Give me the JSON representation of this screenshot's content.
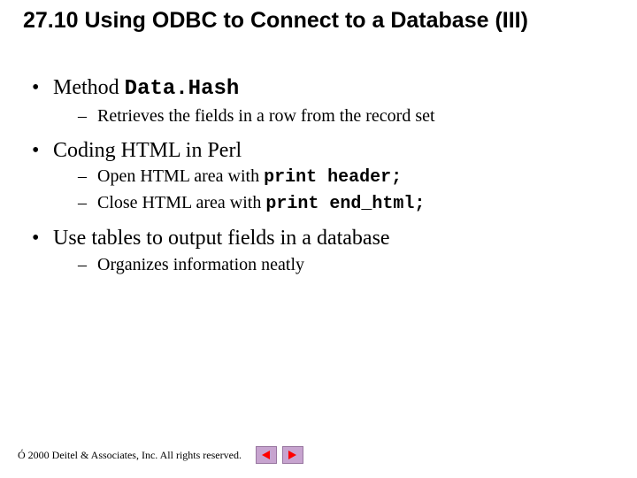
{
  "title": "27.10 Using ODBC to Connect to a Database (III)",
  "bullets": {
    "b1": {
      "pre": "Method ",
      "code": "Data.Hash"
    },
    "b1s1": "Retrieves the fields in a row from the record set",
    "b2": "Coding HTML in Perl",
    "b2s1": {
      "pre": "Open HTML area with ",
      "code": "print header;"
    },
    "b2s2": {
      "pre": "Close HTML area with ",
      "code": "print end_html;"
    },
    "b3": "Use tables to output fields in a database",
    "b3s1": "Organizes information neatly"
  },
  "footer": {
    "copyright": "Ó 2000 Deitel & Associates, Inc.  All rights reserved."
  },
  "icons": {
    "prev": "nav-prev",
    "next": "nav-next"
  }
}
